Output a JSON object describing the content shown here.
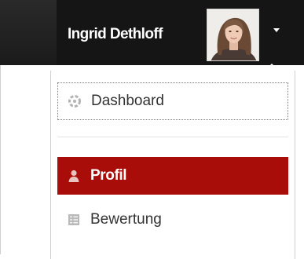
{
  "header": {
    "user_name": "Ingrid Dethloff",
    "avatar_icon": "user-avatar-photo",
    "toggle_icon": "caret-down-icon"
  },
  "user_menu": {
    "items": [
      {
        "label": "Dashboard",
        "icon": "dashboard-icon",
        "focused": true
      },
      {
        "label": "Profil",
        "icon": "user-icon",
        "active": true
      },
      {
        "label": "Bewertung",
        "icon": "list-icon"
      }
    ]
  },
  "colors": {
    "header_background": "#151515",
    "active_item": "#a90d0a",
    "text": "#333333"
  }
}
